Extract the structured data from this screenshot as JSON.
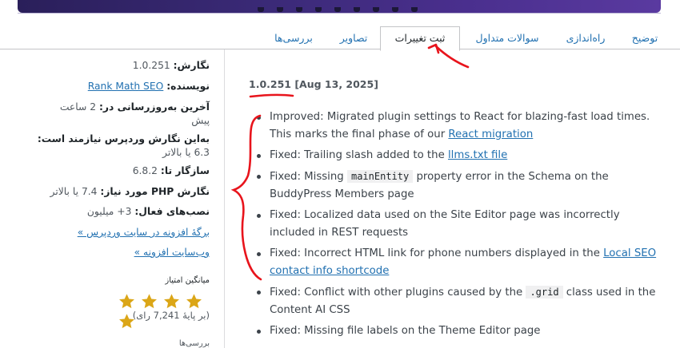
{
  "tabs": [
    {
      "label": "توضیح"
    },
    {
      "label": "راه‌اندازی"
    },
    {
      "label": "سوالات متداول"
    },
    {
      "label": "ثبت تغییرات",
      "active": true
    },
    {
      "label": "تصاویر"
    },
    {
      "label": "بررسی‌ها"
    }
  ],
  "sidebar": {
    "version": {
      "label": "نگارش:",
      "value": "1.0.251"
    },
    "author": {
      "label": "نویسنده:",
      "value": "Rank Math SEO"
    },
    "updated": {
      "label": "آخرین به‌روزرسانی در:",
      "value": "2 ساعت",
      "value2": "پیش"
    },
    "wp_required": {
      "label": "به‌این نگارش وردپرس نیازمند است:",
      "value": "6.3 یا بالاتر"
    },
    "tested": {
      "label": "سازگار تا:",
      "value": "6.8.2"
    },
    "php_required": {
      "label": "نگارش PHP مورد نیاز:",
      "value": "7.4 یا بالاتر"
    },
    "installs": {
      "label": "نصب‌های فعال:",
      "value": "3+ میلیون"
    },
    "plugin_page_link": "برگهٔ افزونه در سایت وردپرس »",
    "plugin_site_link": "وب‌سایت افزونه »",
    "rating_title": "میانگین امتیاز",
    "rating": 5,
    "rating_max": 5,
    "rating_count": "(بر پایهٔ 7,241 رای)",
    "more_title": "بررسی‌ها"
  },
  "changelog": {
    "version_heading": "1.0.251 [Aug 13, 2025]",
    "items": [
      {
        "parts": [
          {
            "t": "Improved: Migrated plugin settings to React for blazing-fast load times. This marks the final phase of our "
          },
          {
            "t": "React migration",
            "link": true
          }
        ]
      },
      {
        "parts": [
          {
            "t": "Fixed: Trailing slash added to the "
          },
          {
            "t": "llms.txt file",
            "link": true
          }
        ]
      },
      {
        "parts": [
          {
            "t": "Fixed: Missing "
          },
          {
            "t": "mainEntity",
            "code": true
          },
          {
            "t": " property error in the Schema on the BuddyPress Members page"
          }
        ]
      },
      {
        "parts": [
          {
            "t": "Fixed: Localized data used on the Site Editor page was incorrectly included in REST requests"
          }
        ]
      },
      {
        "parts": [
          {
            "t": "Fixed: Incorrect HTML link for phone numbers displayed in the "
          },
          {
            "t": "Local SEO contact info shortcode",
            "link": true
          }
        ]
      },
      {
        "parts": [
          {
            "t": "Fixed: Conflict with other plugins caused by the "
          },
          {
            "t": ".grid",
            "code": true
          },
          {
            "t": " class used in the Content AI CSS"
          }
        ]
      },
      {
        "parts": [
          {
            "t": "Fixed: Missing file labels on the Theme Editor page"
          }
        ]
      }
    ]
  },
  "colors": {
    "link": "#2271b1",
    "annotation": "#e8141c",
    "star": "#dba617",
    "banner": "#3b2a78"
  }
}
